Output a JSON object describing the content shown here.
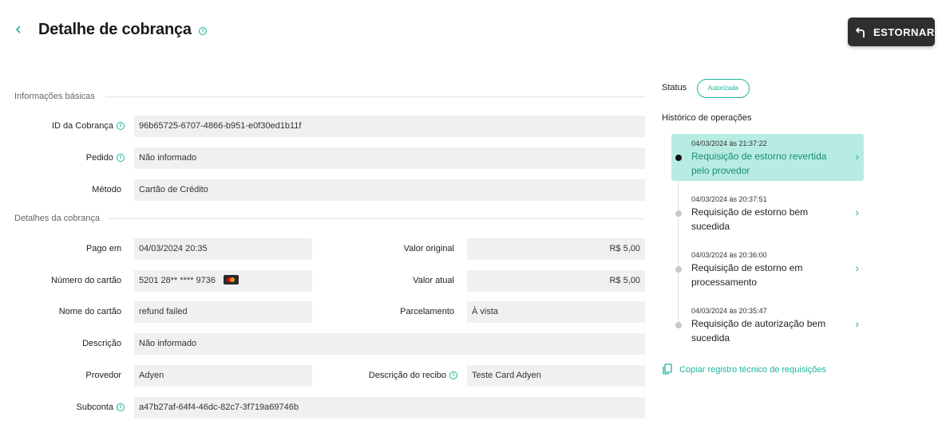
{
  "header": {
    "title": "Detalhe de cobrança",
    "back_icon": "chevron-left-icon",
    "refund_button_label": "ESTORNAR",
    "refund_icon": "undo-arrow-icon"
  },
  "sections": {
    "basic_title": "Informações básicas",
    "details_title": "Detalhes da cobrança"
  },
  "basic": {
    "charge_id_label": "ID da Cobrança",
    "charge_id_value": "96b65725-6707-4866-b951-e0f30ed1b11f",
    "order_label": "Pedido",
    "order_value": "Não informado",
    "method_label": "Método",
    "method_value": "Cartão de Crédito"
  },
  "details": {
    "paid_at_label": "Pago em",
    "paid_at_value": "04/03/2024 20:35",
    "original_value_label": "Valor original",
    "original_value": "R$ 5,00",
    "card_number_label": "Número do cartão",
    "card_number_value": "5201 28** **** 9736",
    "card_brand_icon": "mastercard-icon",
    "current_value_label": "Valor atual",
    "current_value": "R$ 5,00",
    "card_name_label": "Nome do cartão",
    "card_name_value": "refund failed",
    "installments_label": "Parcelamento",
    "installments_value": "À vista",
    "description_label": "Descrição",
    "description_value": "Não informado",
    "provider_label": "Provedor",
    "provider_value": "Adyen",
    "receipt_desc_label": "Descrição do recibo",
    "receipt_desc_value": "Teste Card Adyen",
    "subaccount_label": "Subconta",
    "subaccount_value": "a47b27af-64f4-46dc-82c7-3f719a69746b"
  },
  "status": {
    "label": "Status",
    "value": "Autorizada",
    "color": "#1bb39a"
  },
  "history": {
    "title": "Histórico de operações",
    "operations": [
      {
        "timestamp": "04/03/2024 às 21:37:22",
        "text": "Requisição de estorno revertida pelo provedor",
        "active": true
      },
      {
        "timestamp": "04/03/2024 às 20:37:51",
        "text": "Requisição de estorno bem sucedida",
        "active": false
      },
      {
        "timestamp": "04/03/2024 às 20:36:00",
        "text": "Requisição de estorno em processamento",
        "active": false
      },
      {
        "timestamp": "04/03/2024 às 20:35:47",
        "text": "Requisição de autorização bem sucedida",
        "active": false
      }
    ],
    "copy_link_label": "Copiar registro técnico de requisições",
    "copy_icon": "copy-icon"
  },
  "colors": {
    "accent": "#1bb39a",
    "active_bg": "#b7ece3",
    "button_bg": "#2e2e2e"
  }
}
